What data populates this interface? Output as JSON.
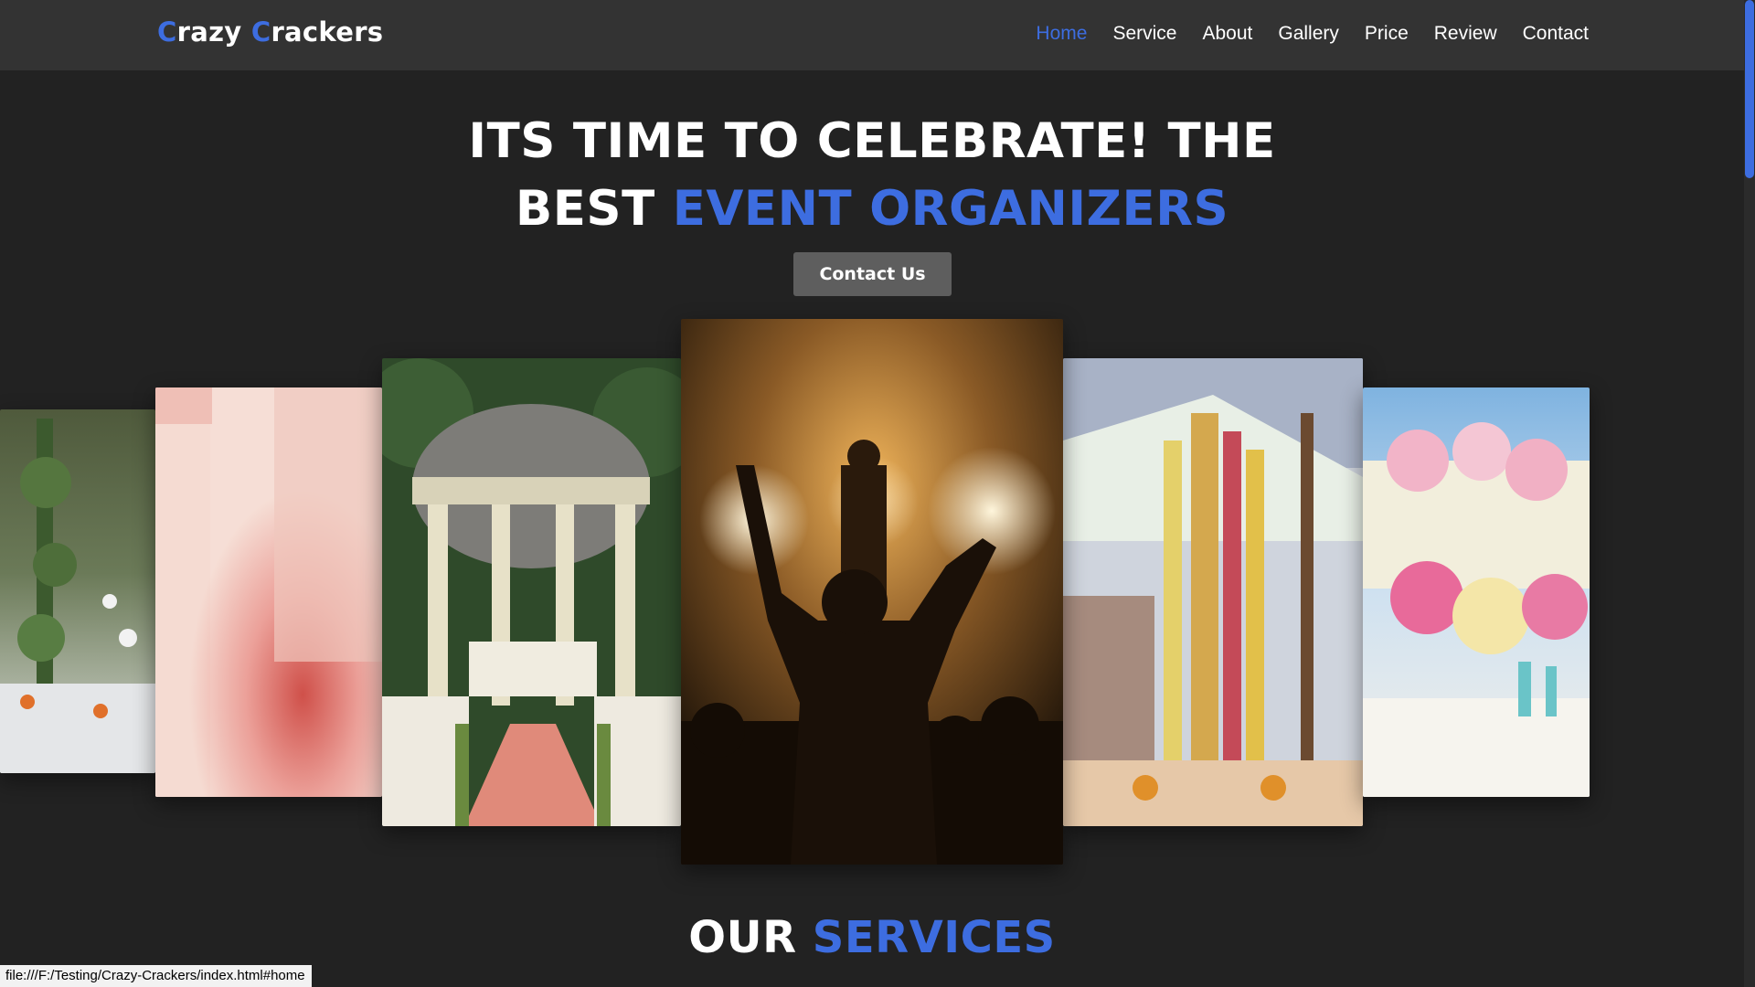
{
  "header": {
    "logo": {
      "word1_cap": "C",
      "word1_rest": "razy",
      "word2_cap": "C",
      "word2_rest": "rackers"
    },
    "nav": [
      {
        "label": "Home",
        "active": true
      },
      {
        "label": "Service"
      },
      {
        "label": "About"
      },
      {
        "label": "Gallery"
      },
      {
        "label": "Price"
      },
      {
        "label": "Review"
      },
      {
        "label": "Contact"
      }
    ]
  },
  "hero": {
    "line1": "ITS TIME TO CELEBRATE! THE",
    "line2_plain": "BEST",
    "line2_accent": "EVENT ORGANIZERS",
    "cta_label": "Contact Us"
  },
  "gallery": {
    "images": [
      "outdoor-banquet-table-photo",
      "bridal-attire-photo",
      "garden-gazebo-photo",
      "concert-crowd-photo",
      "floral-mandap-photo",
      "wedding-table-flowers-photo"
    ]
  },
  "services": {
    "title_plain": "OUR",
    "title_accent": "SERVICES"
  },
  "status_bar": {
    "url": "file:///F:/Testing/Crazy-Crackers/index.html#home"
  },
  "colors": {
    "accent": "#3d6de0",
    "background": "#222222",
    "header": "#333333",
    "button": "#5e5e5e"
  }
}
